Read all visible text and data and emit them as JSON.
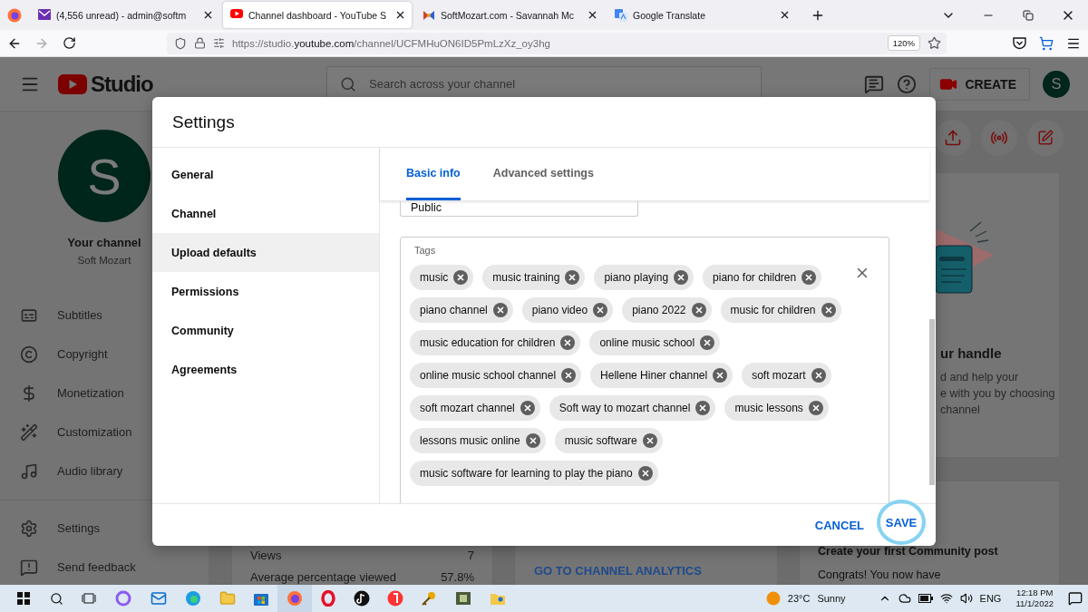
{
  "browser": {
    "tabs": [
      {
        "title": "(4,556 unread) - admin@softm",
        "selected": false,
        "kind": "mail"
      },
      {
        "title": "Channel dashboard - YouTube S",
        "selected": true,
        "kind": "video"
      },
      {
        "title": "SoftMozart.com - Savannah Mc",
        "selected": false,
        "kind": "site"
      },
      {
        "title": "Google Translate",
        "selected": false,
        "kind": "translate"
      }
    ],
    "url": {
      "prefix": "https://studio.",
      "domain": "youtube.com",
      "path": "/channel/UCFMHuON6ID5PmLzXz_oy3hg"
    },
    "zoom": "120%"
  },
  "studio": {
    "logo": "Studio",
    "search": {
      "placeholder": "Search across your channel"
    },
    "create": "CREATE",
    "avatar": "S",
    "channel": {
      "avatar": "S",
      "title": "Your channel",
      "name": "Soft Mozart"
    },
    "nav": [
      {
        "label": "Subtitles",
        "kind": "subtitles"
      },
      {
        "label": "Copyright",
        "kind": "copyright"
      },
      {
        "label": "Monetization",
        "kind": "money"
      },
      {
        "label": "Customization",
        "kind": "wand"
      },
      {
        "label": "Audio library",
        "kind": "audio"
      }
    ],
    "footer_nav": [
      {
        "label": "Settings",
        "kind": "settings"
      },
      {
        "label": "Send feedback",
        "kind": "feedback"
      }
    ],
    "handle_card": {
      "title": "ur handle",
      "body": [
        "d and help your",
        "e with you by choosing",
        "channel"
      ]
    },
    "analytics_card": {
      "rows": [
        {
          "label": "Views",
          "value": "7"
        },
        {
          "label": "Average percentage viewed",
          "value": "57.8%"
        }
      ]
    },
    "analytics_link": "GO TO CHANNEL ANALYTICS",
    "community_card": {
      "title": "Create your first Community post",
      "body": "Congrats! You now have"
    }
  },
  "dialog": {
    "title": "Settings",
    "sections": [
      {
        "label": "General",
        "selected": false
      },
      {
        "label": "Channel",
        "selected": false
      },
      {
        "label": "Upload defaults",
        "selected": true
      },
      {
        "label": "Permissions",
        "selected": false
      },
      {
        "label": "Community",
        "selected": false
      },
      {
        "label": "Agreements",
        "selected": false
      }
    ],
    "tabs": [
      {
        "label": "Basic info",
        "selected": true
      },
      {
        "label": "Advanced settings",
        "selected": false
      }
    ],
    "visibility": {
      "value": "Public"
    },
    "tags": {
      "label": "Tags",
      "items": [
        "music",
        "music training",
        "piano playing",
        "piano for children",
        "piano channel",
        "piano video",
        "piano 2022",
        "music for children",
        "music education for children",
        "online music school",
        "online music school channel",
        "Hellene Hiner channel",
        "soft mozart",
        "soft mozart channel",
        "Soft way to mozart channel",
        "music lessons",
        "lessons music online",
        "music software",
        "music software for learning to play the piano"
      ]
    },
    "cancel": "CANCEL",
    "save": "SAVE"
  },
  "taskbar": {
    "temperature": "23°C",
    "condition": "Sunny",
    "language": "ENG",
    "time": "12:18 PM",
    "date": "11/1/2022"
  }
}
